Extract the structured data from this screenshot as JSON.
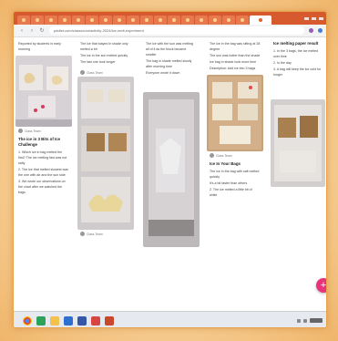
{
  "browser": {
    "url": "padlet.com/classroom/activity-2024/ice-melt-experiment",
    "tab_count": 18
  },
  "columns": [
    {
      "top_text": "Reported by students in early morning",
      "author": "Class Team",
      "title": "The ice in 3 Bits of Ice Challenge",
      "body": [
        "1. Which ice in bag melted the first? The ice melting fast was not salty",
        "2. The ice that melted slowest was the one with air and the sun side",
        "3. We wrote our observations on the chart after we watched the bags"
      ]
    },
    {
      "top_text": [
        "The ice that stayed in shade only melted a bit",
        "The ice in the sun melted quickly",
        "The last one took longer"
      ],
      "author": "Class Team",
      "caption": ""
    },
    {
      "body": [
        "The ice with the sun was melting all of it as the block became smaller",
        "The bag in shade melted slowly after morning time",
        "Everyone wrote it down"
      ]
    },
    {
      "top_text": [
        "The ice in the bag was sitting at 28 degree",
        "The sun was hotter than the shade",
        "Ice bag in shade took more time",
        "Description: Add ice into 3 bags"
      ],
      "author": "Class Team",
      "title": "Ice In Your Bags",
      "body": [
        "The ice in the bag with salt melted quickly",
        "It's a bit faster than others",
        "2. The ice melted a little bit of white"
      ]
    },
    {
      "title": "Ice melting paper result",
      "body": [
        "1. In the 3 bags, the ice melted over time",
        "2. In the day",
        "3. A bag will keep the ice cold for longer"
      ]
    }
  ],
  "fab": {
    "label": "+"
  },
  "taskbar": {
    "icons": [
      "chrome-icon",
      "edge-icon",
      "files-icon",
      "mail-icon",
      "store-icon",
      "photos-icon",
      "powerpoint-icon"
    ]
  }
}
